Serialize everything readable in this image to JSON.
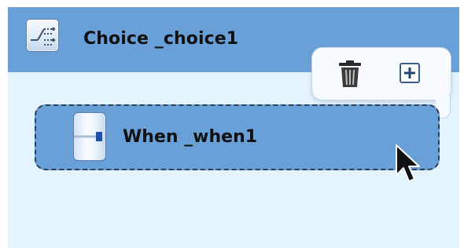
{
  "choice": {
    "title": "Choice _choice1",
    "icon": "choice-branch-icon"
  },
  "toolbar": {
    "delete_icon": "trash-icon",
    "add_icon": "plus-icon"
  },
  "when": {
    "title": "When _when1",
    "icon": "when-connector-icon"
  },
  "colors": {
    "header": "#6aa0d8",
    "container": "#e4f4ff",
    "node": "#6aa0d8",
    "node_border": "#2d3e55"
  }
}
